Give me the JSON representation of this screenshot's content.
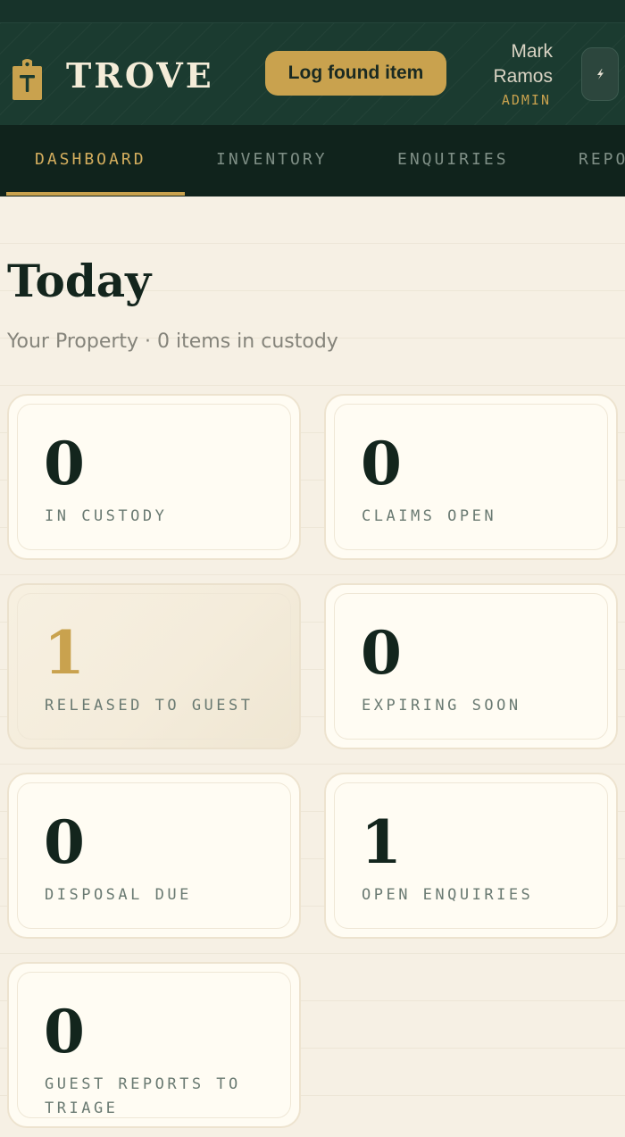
{
  "header": {
    "brand": "TROVE",
    "log_button": "Log found item",
    "user_first": "Mark",
    "user_last": "Ramos",
    "user_role": "ADMIN",
    "brand_color": "#1b3b30",
    "accent_color": "#c9a24e"
  },
  "nav": {
    "tabs": [
      {
        "label": "DASHBOARD",
        "active": true
      },
      {
        "label": "INVENTORY",
        "active": false
      },
      {
        "label": "ENQUIRIES",
        "active": false
      },
      {
        "label": "REPORTS",
        "active": false
      }
    ]
  },
  "main": {
    "title": "Today",
    "subtitle": "Your Property · 0 items in custody",
    "cards": [
      {
        "value": "0",
        "label": "IN CUSTODY"
      },
      {
        "value": "0",
        "label": "CLAIMS OPEN"
      },
      {
        "value": "1",
        "label": "RELEASED TO GUEST"
      },
      {
        "value": "0",
        "label": "EXPIRING SOON"
      },
      {
        "value": "0",
        "label": "DISPOSAL DUE"
      },
      {
        "value": "1",
        "label": "OPEN ENQUIRIES"
      },
      {
        "value": "0",
        "label": "GUEST REPORTS TO TRIAGE"
      }
    ]
  }
}
